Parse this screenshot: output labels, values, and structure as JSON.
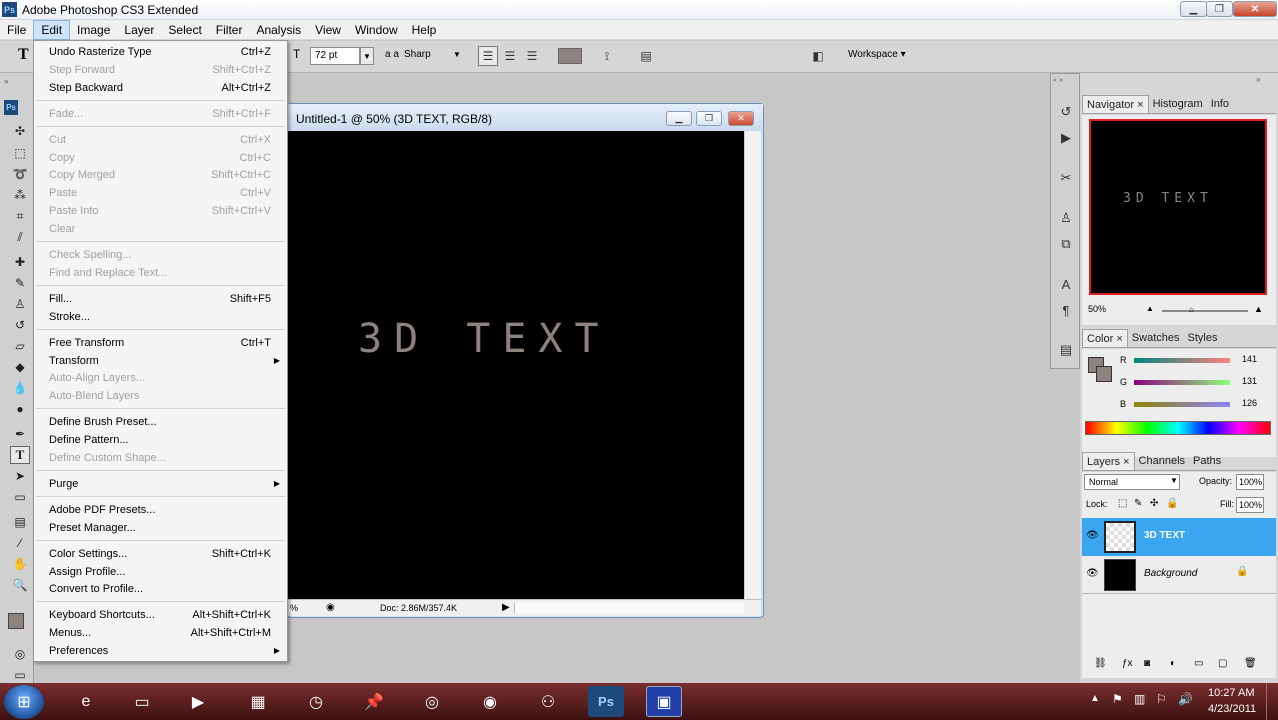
{
  "window": {
    "title": "Adobe Photoshop CS3 Extended",
    "logo": "Ps"
  },
  "menubar": [
    "File",
    "Edit",
    "Image",
    "Layer",
    "Select",
    "Filter",
    "Analysis",
    "View",
    "Window",
    "Help"
  ],
  "options": {
    "font_size": "72 pt",
    "antialias_icon": "a a",
    "antialias": "Sharp",
    "workspace": "Workspace ▾"
  },
  "document": {
    "title": "Untitled-1 @ 50% (3D TEXT, RGB/8)",
    "canvas_text": "3D TEXT",
    "zoom": "%",
    "doc_info": "Doc: 2.86M/357.4K"
  },
  "edit_menu": {
    "items": [
      {
        "label": "Undo Rasterize Type",
        "shortcut": "Ctrl+Z",
        "disabled": false
      },
      {
        "label": "Step Forward",
        "shortcut": "Shift+Ctrl+Z",
        "disabled": true
      },
      {
        "label": "Step Backward",
        "shortcut": "Alt+Ctrl+Z",
        "disabled": false
      },
      {
        "label": "Fade...",
        "shortcut": "Shift+Ctrl+F",
        "disabled": true
      },
      {
        "label": "Cut",
        "shortcut": "Ctrl+X",
        "disabled": true
      },
      {
        "label": "Copy",
        "shortcut": "Ctrl+C",
        "disabled": true
      },
      {
        "label": "Copy Merged",
        "shortcut": "Shift+Ctrl+C",
        "disabled": true
      },
      {
        "label": "Paste",
        "shortcut": "Ctrl+V",
        "disabled": true
      },
      {
        "label": "Paste Into",
        "shortcut": "Shift+Ctrl+V",
        "disabled": true
      },
      {
        "label": "Clear",
        "shortcut": "",
        "disabled": true
      },
      {
        "label": "Check Spelling...",
        "shortcut": "",
        "disabled": true
      },
      {
        "label": "Find and Replace Text...",
        "shortcut": "",
        "disabled": true
      },
      {
        "label": "Fill...",
        "shortcut": "Shift+F5",
        "disabled": false
      },
      {
        "label": "Stroke...",
        "shortcut": "",
        "disabled": false
      },
      {
        "label": "Free Transform",
        "shortcut": "Ctrl+T",
        "disabled": false
      },
      {
        "label": "Transform",
        "shortcut": "",
        "disabled": false,
        "submenu": true
      },
      {
        "label": "Auto-Align Layers...",
        "shortcut": "",
        "disabled": true
      },
      {
        "label": "Auto-Blend Layers",
        "shortcut": "",
        "disabled": true
      },
      {
        "label": "Define Brush Preset...",
        "shortcut": "",
        "disabled": false
      },
      {
        "label": "Define Pattern...",
        "shortcut": "",
        "disabled": false
      },
      {
        "label": "Define Custom Shape...",
        "shortcut": "",
        "disabled": true
      },
      {
        "label": "Purge",
        "shortcut": "",
        "disabled": false,
        "submenu": true
      },
      {
        "label": "Adobe PDF Presets...",
        "shortcut": "",
        "disabled": false
      },
      {
        "label": "Preset Manager...",
        "shortcut": "",
        "disabled": false
      },
      {
        "label": "Color Settings...",
        "shortcut": "Shift+Ctrl+K",
        "disabled": false
      },
      {
        "label": "Assign Profile...",
        "shortcut": "",
        "disabled": false
      },
      {
        "label": "Convert to Profile...",
        "shortcut": "",
        "disabled": false
      },
      {
        "label": "Keyboard Shortcuts...",
        "shortcut": "Alt+Shift+Ctrl+K",
        "disabled": false
      },
      {
        "label": "Menus...",
        "shortcut": "Alt+Shift+Ctrl+M",
        "disabled": false
      },
      {
        "label": "Preferences",
        "shortcut": "",
        "disabled": false,
        "submenu": true
      }
    ]
  },
  "navigator": {
    "tabs": [
      "Navigator",
      "Histogram",
      "Info"
    ],
    "preview_text": "3D TEXT",
    "zoom": "50%"
  },
  "color_panel": {
    "tabs": [
      "Color",
      "Swatches",
      "Styles"
    ],
    "channels": [
      {
        "name": "R",
        "value": "141"
      },
      {
        "name": "G",
        "value": "131"
      },
      {
        "name": "B",
        "value": "126"
      }
    ],
    "foreground": "#8d837e"
  },
  "layers_panel": {
    "tabs": [
      "Layers",
      "Channels",
      "Paths"
    ],
    "blend_mode": "Normal",
    "opacity_label": "Opacity:",
    "opacity": "100%",
    "lock_label": "Lock:",
    "fill_label": "Fill:",
    "fill": "100%",
    "layers": [
      {
        "name": "3D TEXT",
        "selected": true
      },
      {
        "name": "Background",
        "selected": false
      }
    ]
  },
  "taskbar": {
    "time": "10:27 AM",
    "date": "4/23/2011"
  }
}
